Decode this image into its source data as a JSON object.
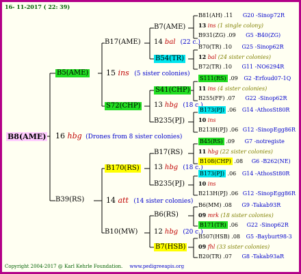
{
  "date_line": "16- 11-2017 ( 22: 39)",
  "footer": {
    "copyright": "Copyright 2004-2017 @ Karl Kehrle Foundation.",
    "url": "www.pedigreeapis.org"
  },
  "colors": {
    "frame": "#b30088",
    "green": "#22dd22",
    "cyan": "#00e5ee",
    "yellow": "#ffff00",
    "pink": "#ffccff",
    "red": "#c00000",
    "blue": "#0000cc"
  },
  "root": {
    "name": "B8(AME)",
    "gen_num": "16",
    "gen_code": "hbg",
    "note": "(Drones from 8 sister colonies)"
  },
  "g1": [
    {
      "name": "B5(AME)",
      "gen_num": "15",
      "gen_code": "ins",
      "note": "(5 sister colonies)"
    },
    {
      "name": "B39(RS)",
      "gen_num": "14",
      "gen_code": "att",
      "note": "(14 sister colonies)"
    }
  ],
  "g2": [
    {
      "name": "B17(AME)",
      "gen_num": "14",
      "gen_code": "bal",
      "note": "(22 c.)"
    },
    {
      "name": "S72(CHP)",
      "gen_num": "13",
      "gen_code": "hbg",
      "note": "(18 c.)"
    },
    {
      "name": "B170(RS)",
      "gen_num": "13",
      "gen_code": "hbg",
      "note": "(18 c.)"
    },
    {
      "name": "B10(MW)",
      "gen_num": "12",
      "gen_code": "hbg",
      "note": "(20 c.)"
    }
  ],
  "g3": [
    "B7(AME)",
    "B54(TR)",
    "S41(CHP)",
    "B235(PJ)",
    "B17(RS)",
    "B235(PJ)",
    "B6(RS)",
    "B7(HSB)"
  ],
  "g4": [
    {
      "name": "B81(AH)",
      "num": ".11",
      "src": "G20 -Sinop72R"
    },
    {
      "gen_num": "13",
      "gen_code": "ins",
      "note": "(1 single colony)"
    },
    {
      "name": "B931(ZG)",
      "num": ".09",
      "src": "G5 -B40(ZG)"
    },
    {
      "name": "B70(TR)",
      "num": ".10",
      "src": "G25 -Sinop62R"
    },
    {
      "gen_num": "12",
      "gen_code": "bal",
      "note": "(24 sister colonies)"
    },
    {
      "name": "B72(TR)",
      "num": ".10",
      "src": "G11 -NO6294R"
    },
    {
      "name": "S111(RS)",
      "num": ".09",
      "src": "G2 -Erfoud07-1Q"
    },
    {
      "gen_num": "11",
      "gen_code": "ins",
      "note": "(4 sister colonies)"
    },
    {
      "name": "B255(FF)",
      "num": ".07",
      "src": "G22 -Sinop62R"
    },
    {
      "name": "B173(PJ)",
      "num": ".06",
      "src": "G14 -AthosSt80R"
    },
    {
      "gen_num": "10",
      "gen_code": "ins",
      "note": ""
    },
    {
      "name": "B213H(PJ)",
      "num": ".06",
      "src": "G12 -SinopEgg86R"
    },
    {
      "name": "B45(RS)",
      "num": ".09",
      "src": "G7 -notregiste"
    },
    {
      "gen_num": "11",
      "gen_code": "hbg",
      "note": "(22 sister colonies)"
    },
    {
      "name": "B108(CHP)",
      "num": ".08",
      "src": "G6 -B262(NE)"
    },
    {
      "name": "B173(PJ)",
      "num": ".06",
      "src": "G14 -AthosSt80R"
    },
    {
      "gen_num": "10",
      "gen_code": "ins",
      "note": ""
    },
    {
      "name": "B213H(PJ)",
      "num": ".06",
      "src": "G12 -SinopEgg86R"
    },
    {
      "name": "B6(MM)",
      "num": ".08",
      "src": "G9 -Takab93R"
    },
    {
      "gen_num": "09",
      "gen_code": "mrk",
      "note": "(18 sister colonies)"
    },
    {
      "name": "B171(TR)",
      "num": ".06",
      "src": "G22 -Sinop62R"
    },
    {
      "name": "B507(HSB)",
      "num": ".08",
      "src": "G5 -Bayburt98-3"
    },
    {
      "gen_num": "09",
      "gen_code": "fhl",
      "note": "(33 sister colonies)"
    },
    {
      "name": "B20(TR)",
      "num": ".07",
      "src": "G8 -Takab93aR"
    }
  ]
}
